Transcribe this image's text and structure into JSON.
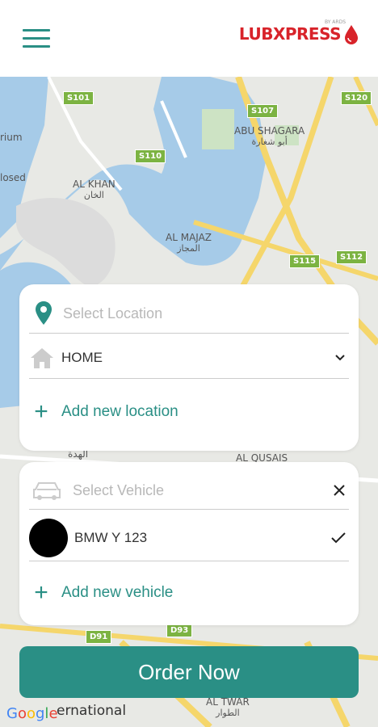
{
  "header": {
    "logo_text": "LUBXPRESS",
    "logo_sub": "BY ARDS"
  },
  "map": {
    "road_signs": [
      "S101",
      "S107",
      "S120",
      "S110",
      "S115",
      "S112",
      "D91",
      "D93"
    ],
    "places": [
      {
        "en": "ABU SHAGARA",
        "ar": "أبو شغارة"
      },
      {
        "en": "AL KHAN",
        "ar": "الخان"
      },
      {
        "en": "AL MAJAZ",
        "ar": "المجاز"
      },
      {
        "en": "AL QUSAIS",
        "ar": ""
      },
      {
        "en": "AL TWAR",
        "ar": "الطوار"
      },
      {
        "en": "ernational",
        "ar": ""
      },
      {
        "en": "rium",
        "ar": ""
      },
      {
        "en": "losed",
        "ar": ""
      },
      {
        "en": "الهدة",
        "ar": ""
      }
    ],
    "attribution": "Google"
  },
  "location_card": {
    "placeholder": "Select Location",
    "selected": "HOME",
    "add_label": "Add new location"
  },
  "vehicle_card": {
    "placeholder": "Select Vehicle",
    "vehicle_name": "BMW Y 123",
    "add_label": "Add new vehicle"
  },
  "order_button": "Order Now",
  "colors": {
    "accent": "#2a8f85",
    "brand": "#d8232a"
  }
}
